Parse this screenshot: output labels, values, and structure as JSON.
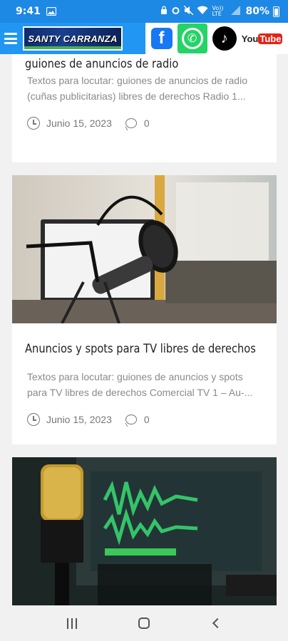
{
  "status_bar": {
    "time": "9:41",
    "network": "Vo)) LTE",
    "battery": "80%"
  },
  "header": {
    "logo_text": "SANTY CARRANZA",
    "social": {
      "facebook": "f",
      "whatsapp": "✆",
      "tiktok": "♪",
      "youtube_you": "You",
      "youtube_tube": "Tube"
    }
  },
  "posts": [
    {
      "title": "guiones de anuncios de radio",
      "excerpt": "Textos para locutar: guiones de anuncios de radio (cuñas publicitarias) libres de derechos Radio 1...",
      "date": "Junio 15, 2023",
      "comments": "0"
    },
    {
      "title": "Anuncios y spots para TV libres de derechos",
      "excerpt": "Textos para locutar: guiones de anuncios y spots para TV libres de derechos Comercial TV 1 – Au-...",
      "date": "Junio 15, 2023",
      "comments": "0",
      "image_icon": "microphone-studio-image"
    },
    {
      "image_icon": "gold-microphone-audio-waveform-image"
    }
  ],
  "colors": {
    "status_bar": "#1e88e5",
    "header_left": "#2196f3",
    "facebook": "#1877f2",
    "whatsapp": "#25d366",
    "youtube": "#e62117"
  }
}
